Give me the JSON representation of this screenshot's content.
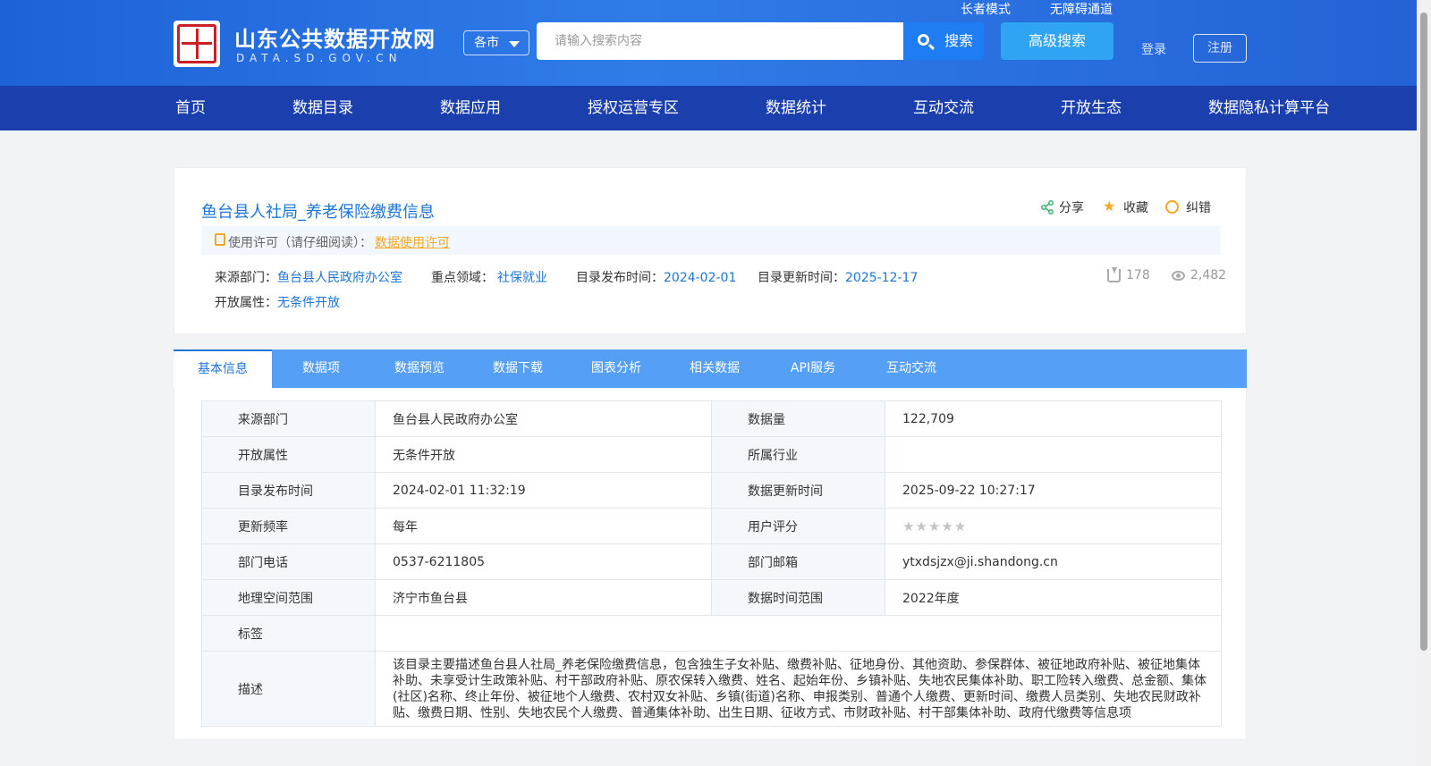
{
  "header": {
    "site_name": "山东公共数据开放网",
    "site_domain": "DATA.SD.GOV.CN",
    "city_select": "各市",
    "search_placeholder": "请输入搜索内容",
    "search_button": "搜索",
    "advanced_search": "高级搜索",
    "elder_mode": "长者模式",
    "accessibility": "无障碍通道",
    "login": "登录",
    "register": "注册"
  },
  "nav": [
    "首页",
    "数据目录",
    "数据应用",
    "授权运营专区",
    "数据统计",
    "互动交流",
    "开放生态",
    "数据隐私计算平台"
  ],
  "dataset": {
    "title": "鱼台县人社局_养老保险缴费信息",
    "actions": {
      "share": "分享",
      "favorite": "收藏",
      "report": "纠错"
    },
    "license_label": "使用许可（请仔细阅读）：",
    "license_link": "数据使用许可",
    "meta": {
      "source_key": "来源部门：",
      "source_val": "鱼台县人民政府办公室",
      "domain_key": "重点领域：",
      "domain_val": "社保就业",
      "publish_key": "目录发布时间：",
      "publish_val": "2024-02-01",
      "update_key": "目录更新时间：",
      "update_val": "2025-12-17",
      "open_key": "开放属性：",
      "open_val": "无条件开放"
    },
    "downloads": "178",
    "views": "2,482"
  },
  "tabs": [
    "基本信息",
    "数据项",
    "数据预览",
    "数据下载",
    "图表分析",
    "相关数据",
    "API服务",
    "互动交流"
  ],
  "info": {
    "rows": [
      {
        "l1": "来源部门",
        "v1": "鱼台县人民政府办公室",
        "l2": "数据量",
        "v2": "122,709"
      },
      {
        "l1": "开放属性",
        "v1": "无条件开放",
        "l2": "所属行业",
        "v2": ""
      },
      {
        "l1": "目录发布时间",
        "v1": "2024-02-01 11:32:19",
        "l2": "数据更新时间",
        "v2": "2025-09-22 10:27:17"
      },
      {
        "l1": "更新频率",
        "v1": "每年",
        "l2": "用户评分",
        "v2": ""
      },
      {
        "l1": "部门电话",
        "v1": "0537-6211805",
        "l2": "部门邮箱",
        "v2": "ytxdsjzx@ji.shandong.cn"
      },
      {
        "l1": "地理空间范围",
        "v1": "济宁市鱼台县",
        "l2": "数据时间范围",
        "v2": "2022年度"
      }
    ],
    "tag_label": "标签",
    "tag_value": "",
    "desc_label": "描述",
    "desc_value": "该目录主要描述鱼台县人社局_养老保险缴费信息，包含独生子女补贴、缴费补贴、征地身份、其他资助、参保群体、被征地政府补贴、被征地集体补助、未享受计生政策补贴、村干部政府补贴、原农保转入缴费、姓名、起始年份、乡镇补贴、失地农民集体补助、职工险转入缴费、总金额、集体(社区)名称、终止年份、被征地个人缴费、农村双女补贴、乡镇(街道)名称、申报类别、普通个人缴费、更新时间、缴费人员类别、失地农民财政补贴、缴费日期、性别、失地农民个人缴费、普通集体补助、出生日期、征收方式、市财政补贴、村干部集体补助、政府代缴费等信息项",
    "rating": 0
  },
  "colors": {
    "header_bg": "#2462d6",
    "nav_bg": "#1b3fad",
    "tabs_bg": "#559ff7",
    "link": "#1d75d6",
    "accent_orange": "#f5a623"
  }
}
